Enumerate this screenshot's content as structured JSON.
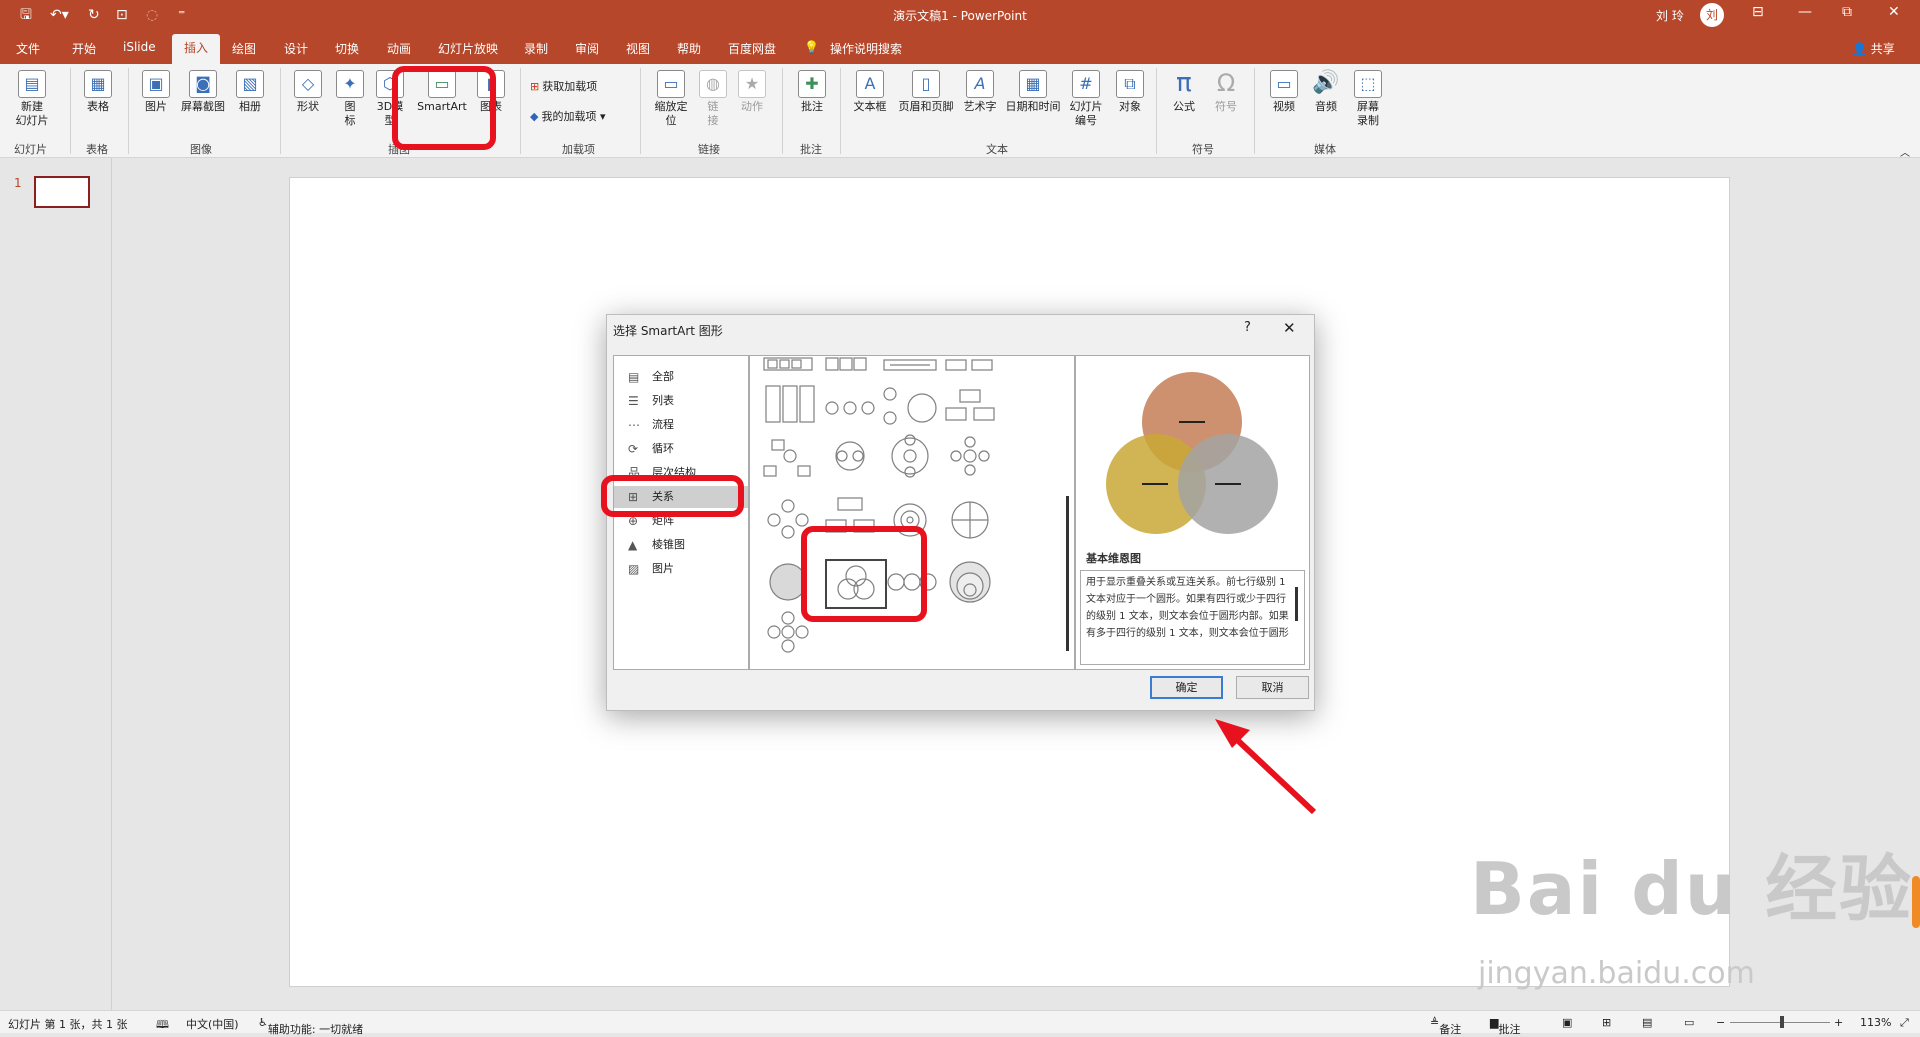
{
  "titlebar": {
    "doc_title": "演示文稿1  -  PowerPoint",
    "user": "刘 玲",
    "avatar": "刘"
  },
  "tabs": [
    "文件",
    "开始",
    "iSlide",
    "插入",
    "绘图",
    "设计",
    "切换",
    "动画",
    "幻灯片放映",
    "录制",
    "审阅",
    "视图",
    "帮助",
    "百度网盘",
    "操作说明搜索"
  ],
  "share": "共享",
  "ribbon": {
    "new_slide": "新建\n幻灯片",
    "table": "表格",
    "pictures": "图片",
    "screenshot": "屏幕截图",
    "album": "相册",
    "shapes": "形状",
    "icons": "图\n标",
    "model3d": "3D模\n型",
    "smartart": "SmartArt",
    "chart": "图表",
    "get_addins": "获取加载项",
    "my_addins": "我的加载项",
    "zoom": "缩放定\n位",
    "link": "链\n接",
    "action": "动作",
    "comment": "批注",
    "textbox": "文本框",
    "header_footer": "页眉和页脚",
    "wordart": "艺术字",
    "datetime": "日期和时间",
    "slide_number": "幻灯片\n编号",
    "object": "对象",
    "equation": "公式",
    "symbol": "符号",
    "video": "视频",
    "audio": "音频",
    "screen_recording": "屏幕\n录制",
    "groups": {
      "slides": "幻灯片",
      "tables": "表格",
      "images": "图像",
      "illustrations": "插图",
      "addins": "加载项",
      "links": "链接",
      "comments": "批注",
      "text": "文本",
      "symbols": "符号",
      "media": "媒体"
    }
  },
  "slide_panel": {
    "number": "1"
  },
  "dialog": {
    "title": "选择 SmartArt 图形",
    "help": "?",
    "categories": [
      "全部",
      "列表",
      "流程",
      "循环",
      "层次结构",
      "关系",
      "矩阵",
      "棱锥图",
      "图片"
    ],
    "selected_category": "关系",
    "preview_name": "基本维恩图",
    "preview_description": "用于显示重叠关系或互连关系。前七行级别 1 文本对应于一个圆形。如果有四行或少于四行的级别 1 文本，则文本会位于圆形内部。如果有多于四行的级别 1 文本，则文本会位于圆形",
    "venn_colors": [
      "#c57e56",
      "#c9a735",
      "#a3a3a3"
    ],
    "ok": "确定",
    "cancel": "取消"
  },
  "statusbar": {
    "slide_info": "幻灯片 第 1 张，共 1 张",
    "language": "中文(中国)",
    "accessibility": "辅助功能: 一切就绪",
    "notes": "备注",
    "comments": "批注",
    "zoom": "113%"
  },
  "watermark": {
    "brand": "Bai  du 经验",
    "url": "jingyan.baidu.com"
  }
}
